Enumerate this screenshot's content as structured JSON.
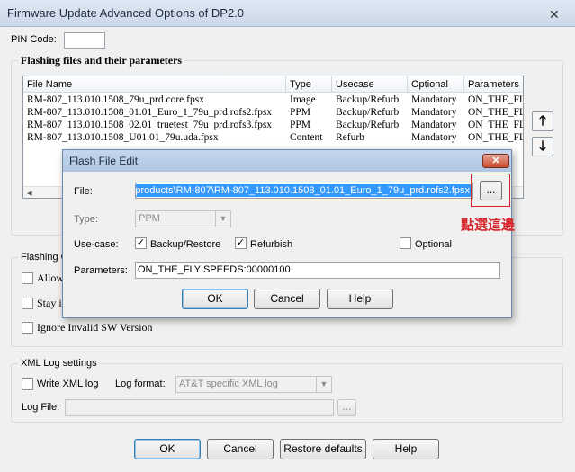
{
  "window": {
    "title": "Firmware Update Advanced Options of DP2.0",
    "close_glyph": "✕"
  },
  "pin": {
    "label": "PIN Code:",
    "value": ""
  },
  "flashing_files": {
    "group_title": "Flashing files and their parameters",
    "columns": [
      "File Name",
      "Type",
      "Usecase",
      "Optional",
      "Parameters"
    ],
    "rows": [
      [
        "RM-807_113.010.1508_79u_prd.core.fpsx",
        "Image",
        "Backup/Refurb",
        "Mandatory",
        "ON_THE_FL"
      ],
      [
        "RM-807_113.010.1508_01.01_Euro_1_79u_prd.rofs2.fpsx",
        "PPM",
        "Backup/Refurb",
        "Mandatory",
        "ON_THE_FL"
      ],
      [
        "RM-807_113.010.1508_02.01_truetest_79u_prd.rofs3.fpsx",
        "PPM",
        "Backup/Refurb",
        "Mandatory",
        "ON_THE_FL"
      ],
      [
        "RM-807_113.010.1508_U01.01_79u.uda.fpsx",
        "Content",
        "Refurb",
        "Mandatory",
        "ON_THE_FL"
      ]
    ],
    "move_up_glyph": "🡑",
    "move_down_glyph": "🡓",
    "scroll_left_glyph": "◂",
    "scroll_right_glyph": "▸"
  },
  "flashing_options": {
    "group_title_partial": "Flashing O",
    "allow_partial": "Allow",
    "stay_partial": "Stay i",
    "ignore_invalid": "Ignore Invalid SW Version"
  },
  "xml_log": {
    "group_title": "XML Log settings",
    "write_xml_label": "Write XML log",
    "log_format_label": "Log format:",
    "log_format_value": "AT&T specific XML log",
    "log_file_label": "Log File:",
    "log_file_value": "",
    "browse_label": "..."
  },
  "main_buttons": {
    "ok": "OK",
    "cancel": "Cancel",
    "restore_defaults": "Restore defaults",
    "help": "Help"
  },
  "dialog": {
    "title": "Flash File Edit",
    "close_glyph": "✕",
    "file_label": "File:",
    "file_value": "products\\RM-807\\RM-807_113.010.1508_01.01_Euro_1_79u_prd.rofs2.fpsx",
    "browse_label": "...",
    "type_label": "Type:",
    "type_value": "PPM",
    "usecase_label": "Use-case:",
    "backup_restore_label": "Backup/Restore",
    "backup_restore_checked": "✓",
    "refurbish_label": "Refurbish",
    "refurbish_checked": "✓",
    "optional_label": "Optional",
    "parameters_label": "Parameters:",
    "parameters_value": "ON_THE_FLY SPEEDS:00000100",
    "ok": "OK",
    "cancel": "Cancel",
    "help": "Help"
  },
  "annotation": {
    "text": "點選這邊",
    "color": "#d7262c"
  }
}
